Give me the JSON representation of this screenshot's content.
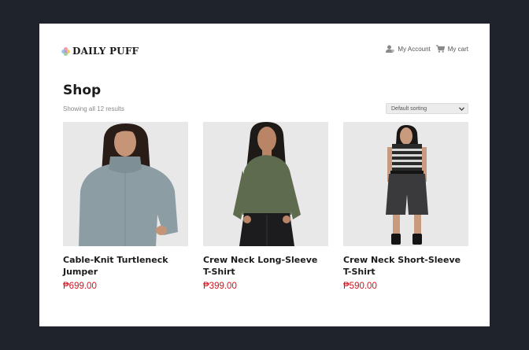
{
  "header": {
    "logo_text": "DAILY PUFF",
    "account_label": "My Account",
    "cart_label": "My cart"
  },
  "shop": {
    "title": "Shop",
    "results_text": "Showing all 12 results",
    "sort_selected": "Default sorting"
  },
  "products": [
    {
      "title": "Cable-Knit Turtleneck Jumper",
      "price": "₱699.00",
      "image": "woman-grey-knit-turtleneck-photo"
    },
    {
      "title": "Crew Neck Long-Sleeve T-Shirt",
      "price": "₱399.00",
      "image": "woman-olive-long-sleeve-tee-photo"
    },
    {
      "title": "Crew Neck Short-Sleeve T-Shirt",
      "price": "₱590.00",
      "image": "woman-striped-tee-black-shorts-photo"
    }
  ],
  "colors": {
    "frame_background": "#1f232b",
    "page_background": "#ffffff",
    "price_red": "#d1121b",
    "image_background": "#e8e8e8"
  },
  "icons": [
    "logo-flower-icon",
    "user-icon",
    "cart-icon",
    "chevron-down-icon"
  ]
}
